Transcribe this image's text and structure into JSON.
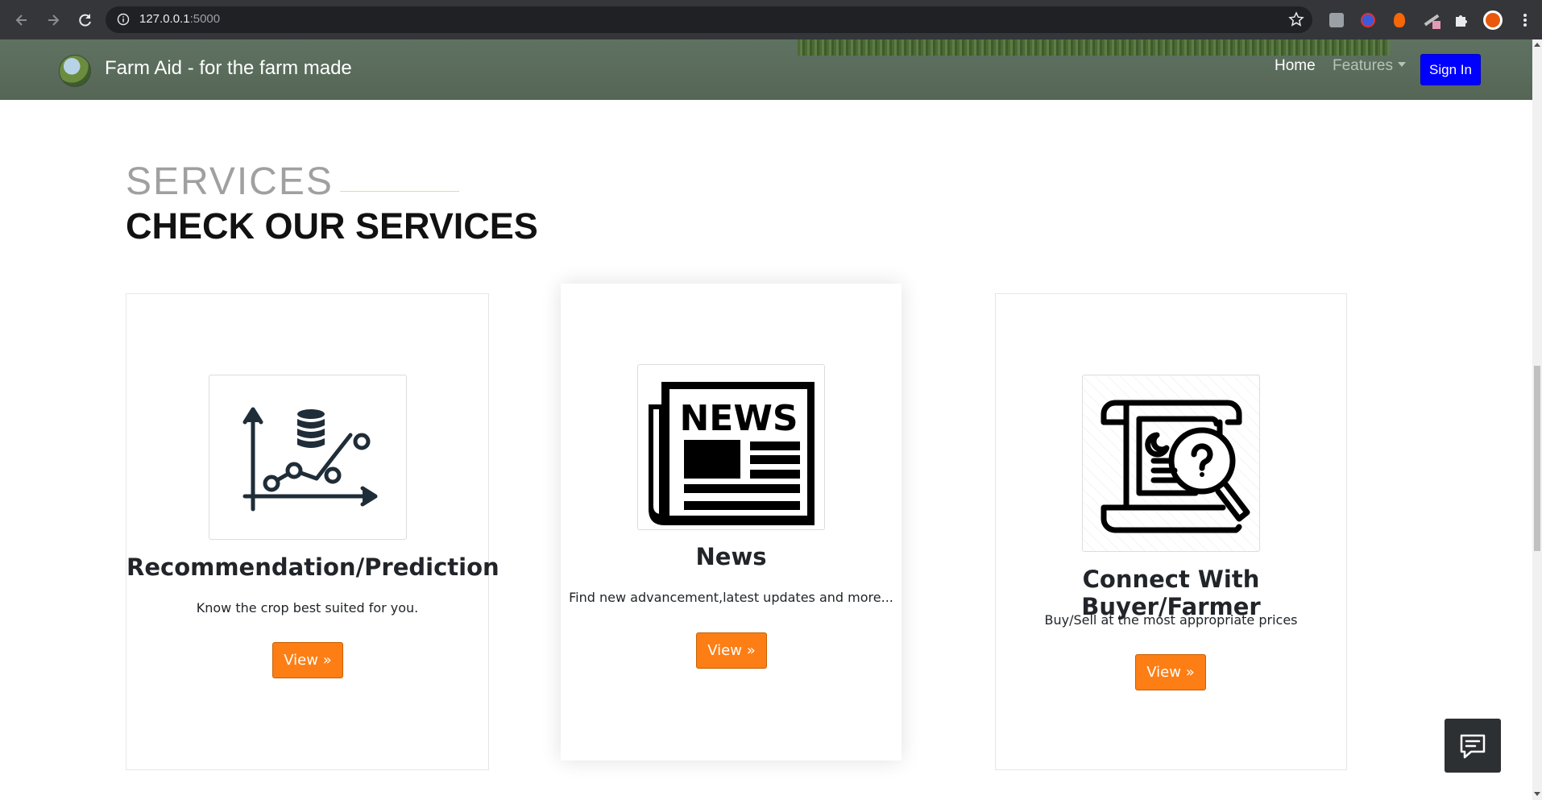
{
  "browser": {
    "url_host": "127.0.0.1",
    "url_port": ":5000"
  },
  "navbar": {
    "brand": "Farm Aid - for the farm made",
    "home": "Home",
    "features": "Features",
    "sign_in": "Sign In"
  },
  "section": {
    "kicker": "SERVICES",
    "title": "CHECK OUR SERVICES"
  },
  "cards": [
    {
      "title": "Recommendation/Prediction",
      "description": "Know the crop best suited for you.",
      "button": "View »",
      "icon": "chart-database-icon"
    },
    {
      "title": "News",
      "description": "Find new advancement,latest updates and more...",
      "button": "View »",
      "icon": "newspaper-icon"
    },
    {
      "title": "Connect With Buyer/Farmer",
      "description": "Buy/Sell at the most appropriate prices",
      "button": "View »",
      "icon": "scroll-magnifier-icon"
    }
  ],
  "news_icon_text": "NEWS",
  "colors": {
    "navbar": "#5a6b5b",
    "sign_in": "#0000ff",
    "view_button": "#fd7e14",
    "chat_button": "#2d3033"
  }
}
